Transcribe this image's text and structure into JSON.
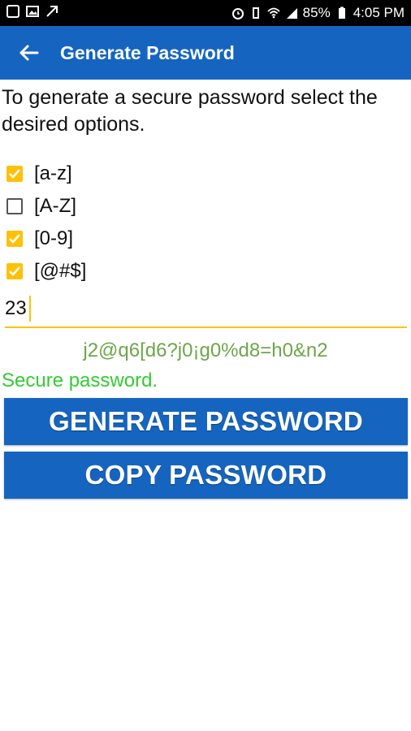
{
  "status": {
    "battery": "85%",
    "time": "4:05 PM"
  },
  "appbar": {
    "title": "Generate Password"
  },
  "intro": "To generate a secure password select the desired options.",
  "options": [
    {
      "label": "[a-z]",
      "checked": true
    },
    {
      "label": "[A-Z]",
      "checked": false
    },
    {
      "label": "[0-9]",
      "checked": true
    },
    {
      "label": "[@#$]",
      "checked": true
    }
  ],
  "length": {
    "value": "23"
  },
  "password": "j2@q6[d6?j0¡g0%d8=h0&n2",
  "strength": "Secure password.",
  "buttons": {
    "generate": "GENERATE PASSWORD",
    "copy": "COPY PASSWORD"
  },
  "colors": {
    "primary": "#1565c0",
    "accent": "#ffc107",
    "password": "#6ea64a",
    "strength": "#33cc33"
  }
}
